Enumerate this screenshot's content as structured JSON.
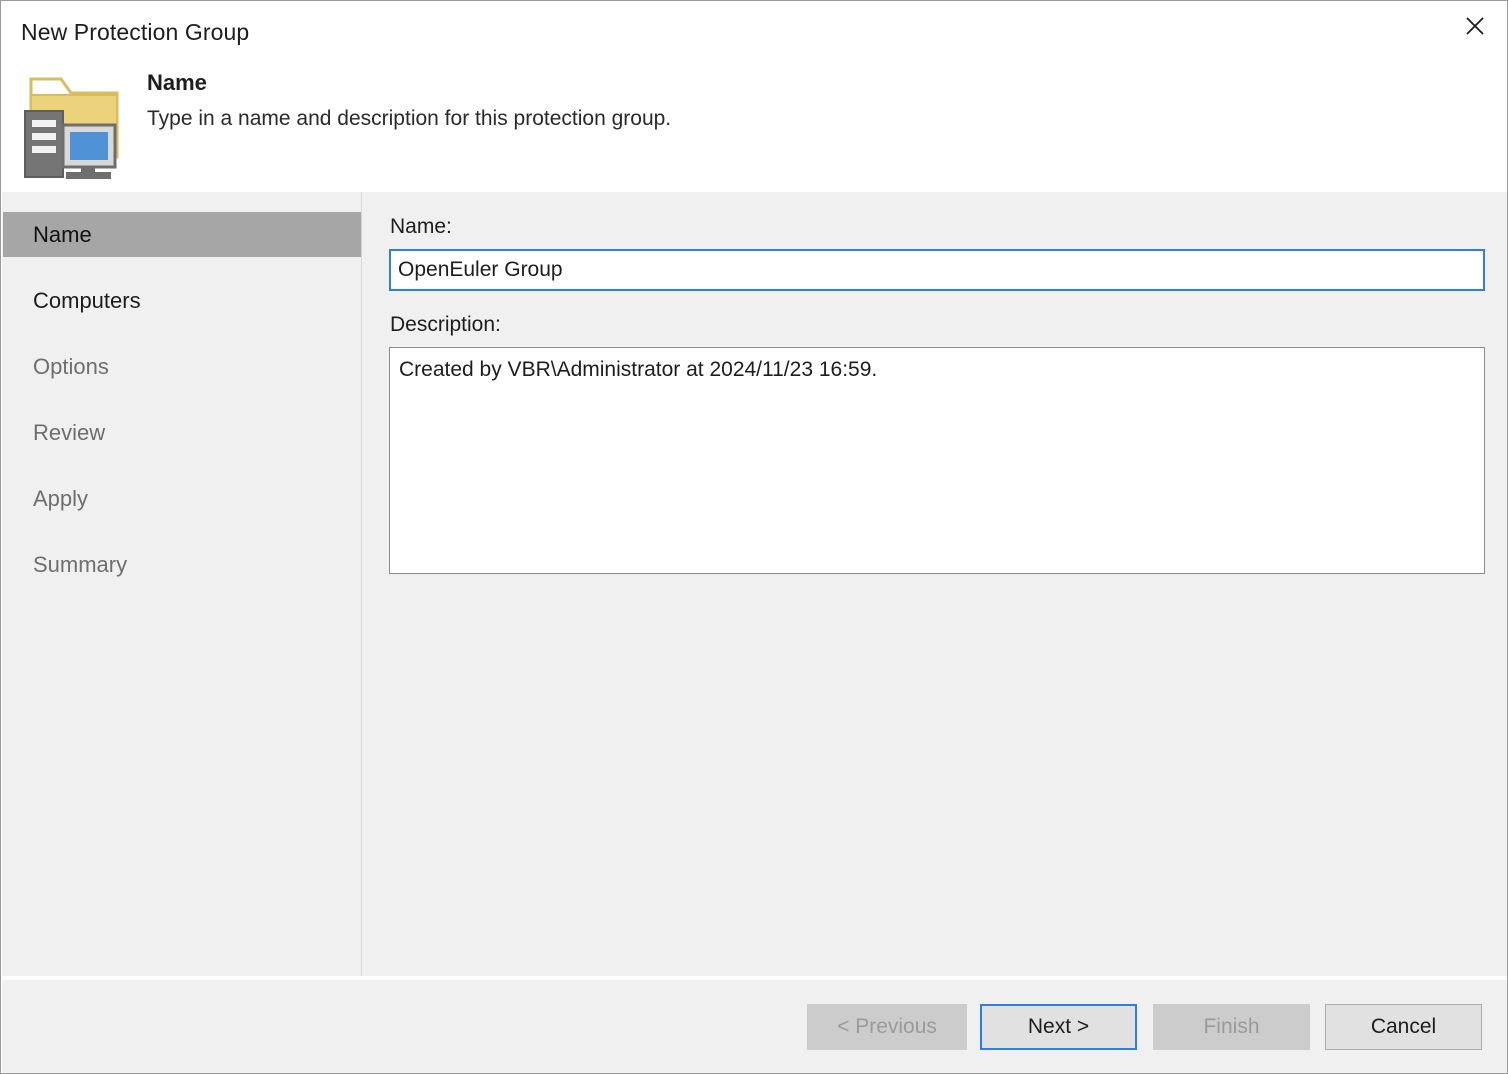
{
  "window": {
    "title": "New Protection Group",
    "close_icon": "close-icon"
  },
  "header": {
    "icon": "protection-group-folder-computer-icon",
    "title": "Name",
    "subtitle": "Type in a name and description for this protection group."
  },
  "sidebar": {
    "items": [
      {
        "label": "Name",
        "state": "active"
      },
      {
        "label": "Computers",
        "state": "enabled"
      },
      {
        "label": "Options",
        "state": "disabled"
      },
      {
        "label": "Review",
        "state": "disabled"
      },
      {
        "label": "Apply",
        "state": "disabled"
      },
      {
        "label": "Summary",
        "state": "disabled"
      }
    ]
  },
  "form": {
    "name_label": "Name:",
    "name_value": "OpenEuler Group",
    "name_placeholder": "",
    "description_label": "Description:",
    "description_value": "Created by VBR\\Administrator at 2024/11/23 16:59."
  },
  "footer": {
    "previous_label": "< Previous",
    "next_label": "Next >",
    "finish_label": "Finish",
    "cancel_label": "Cancel"
  },
  "colors": {
    "accent": "#2f7fe0",
    "selection": "#a6a6a6",
    "surface": "#f0f0f0",
    "folder": "#e8c96a",
    "monitor_screen": "#4f93d6"
  }
}
